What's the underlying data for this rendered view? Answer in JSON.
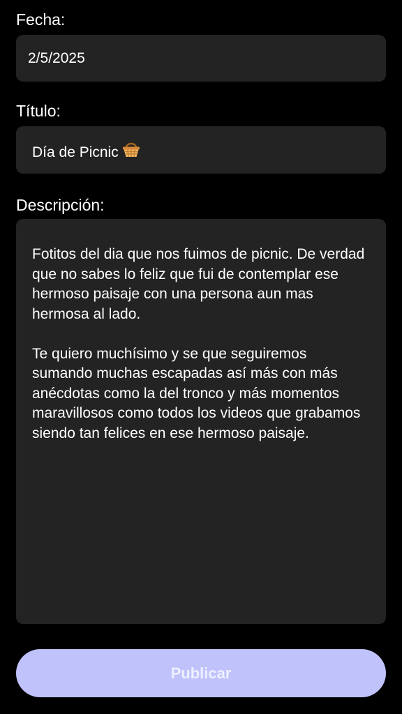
{
  "form": {
    "date_label": "Fecha:",
    "date_value": "2/5/2025",
    "title_label": "Título:",
    "title_value": "Día de Picnic",
    "title_emoji": "basket-icon",
    "description_label": "Descripción:",
    "description_paragraphs": [
      "Fotitos del dia que nos fuimos de picnic. De verdad que no sabes lo feliz que fui de contemplar ese hermoso paisaje con una persona aun mas hermosa al lado.",
      "Te quiero muchísimo y se que seguiremos sumando muchas escapadas así más con más anécdotas como la del tronco y más momentos maravillosos como todos los videos que grabamos siendo tan felices en ese hermoso paisaje."
    ],
    "publish_label": "Publicar"
  },
  "colors": {
    "background": "#000000",
    "field_background": "#232323",
    "button_background": "#c0c2fb",
    "button_text": "#eef0ff"
  }
}
